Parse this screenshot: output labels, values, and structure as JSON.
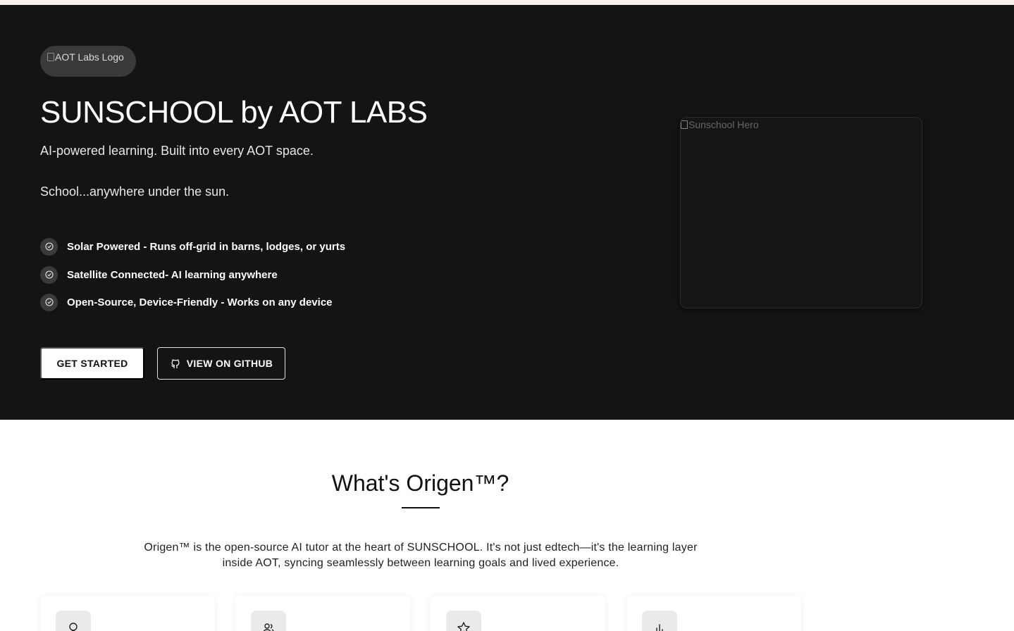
{
  "hero": {
    "logo_alt": "AOT Labs Logo",
    "title": "SUNSCHOOL by AOT LABS",
    "subtitle": "AI-powered learning. Built into every AOT space.",
    "tagline": "School...anywhere under the sun.",
    "features": [
      {
        "label": "Solar Powered - Runs off-grid in barns, lodges, or yurts",
        "icon": "check-circle-icon"
      },
      {
        "label": "Satellite Connected- AI learning anywhere",
        "icon": "check-circle-icon"
      },
      {
        "label": "Open-Source, Device-Friendly - Works on any device",
        "icon": "check-circle-icon"
      }
    ],
    "buttons": {
      "get_started": "GET STARTED",
      "github": "VIEW ON GITHUB",
      "github_icon": "github-icon"
    },
    "hero_image_alt": "Sunschool Hero"
  },
  "origen": {
    "title": "What's Origen™?",
    "description": "Origen™ is the open-source AI tutor at the heart of SUNSCHOOL. It's not just edtech—it's the learning layer inside AOT, syncing seamlessly between learning goals and lived experience.",
    "cards": [
      {
        "icon": "lightbulb-icon"
      },
      {
        "icon": "users-icon"
      },
      {
        "icon": "star-icon"
      },
      {
        "icon": "bar-chart-icon"
      }
    ]
  },
  "colors": {
    "hero_bg": "#141414",
    "top_strip": "#f7f1ea",
    "accent": "#ffffff"
  }
}
